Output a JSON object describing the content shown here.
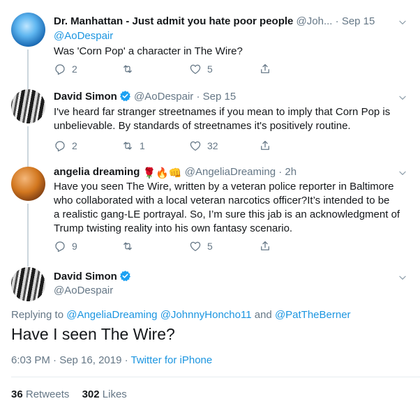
{
  "tweets": [
    {
      "name": "Dr. Manhattan - Just admit you hate poor people",
      "handle": "@Joh...",
      "sep": "·",
      "date": "Sep 15",
      "reply_to": "@AoDespair",
      "text": "Was 'Corn Pop' a character in The Wire?",
      "replies": "2",
      "retweets": "",
      "likes": "5"
    },
    {
      "name": "David Simon",
      "handle": "@AoDespair",
      "sep": "·",
      "date": "Sep 15",
      "text_line1": "I've heard far stranger streetnames if you mean to imply that Corn Pop is",
      "text_line2": "unbelievable. By standards of streetnames it's positively routine.",
      "replies": "2",
      "retweets": "1",
      "likes": "32"
    },
    {
      "name": "angelia dreaming",
      "emojis": "🌹🔥👊",
      "handle": "@AngeliaDreaming",
      "sep": "·",
      "date": "2h",
      "text_line1": "Have you seen The Wire, written by a veteran police reporter in Baltimore",
      "text_line2": "who collaborated with a local veteran narcotics officer?It’s intended to be",
      "text_line3": "a realistic gang-LE portrayal. So, I’m sure this jab is an acknowledgment of",
      "text_line4": "Trump twisting reality into his own fantasy scenario.",
      "replies": "9",
      "retweets": "",
      "likes": "5"
    }
  ],
  "main": {
    "name": "David Simon",
    "handle": "@AoDespair",
    "replying_label": "Replying to",
    "reply_to_1": "@AngeliaDreaming",
    "reply_to_2": "@JohnnyHoncho11",
    "and_label": "and",
    "reply_to_3": "@PatTheBerner",
    "text": "Have I seen The Wire?",
    "time": "6:03 PM · Sep 16, 2019",
    "sep": "·",
    "source": "Twitter for iPhone",
    "retweets_count": "36",
    "retweets_label": "Retweets",
    "likes_count": "302",
    "likes_label": "Likes"
  },
  "icons": [
    "reply-icon",
    "retweet-icon",
    "like-icon",
    "share-icon",
    "verified-badge-icon",
    "chevron-down-icon"
  ],
  "colors": {
    "link": "#1b95e0",
    "muted": "#657786",
    "text": "#14171a",
    "divider": "#e6ecf0"
  }
}
